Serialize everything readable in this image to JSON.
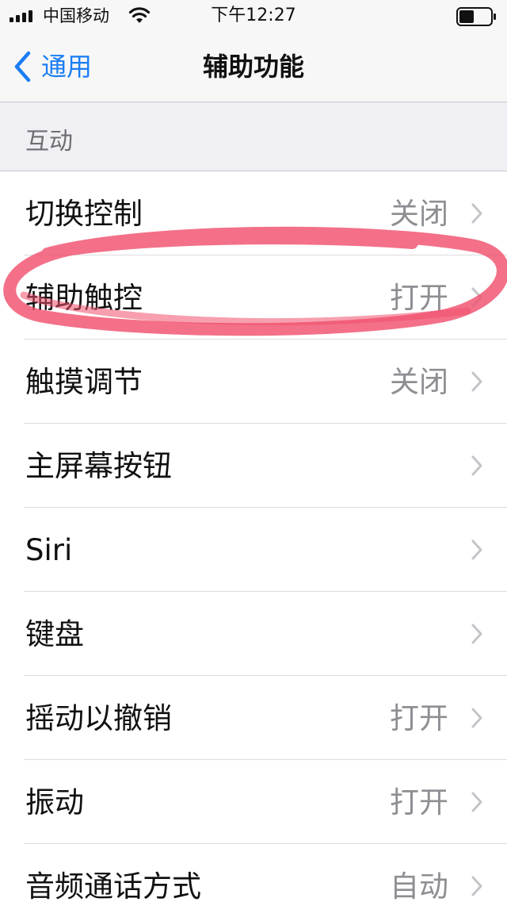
{
  "status_bar": {
    "carrier": "中国移动",
    "time": "下午12:27"
  },
  "nav": {
    "back_label": "通用",
    "title": "辅助功能"
  },
  "section": {
    "title": "互动"
  },
  "rows": [
    {
      "label": "切换控制",
      "value": "关闭"
    },
    {
      "label": "辅助触控",
      "value": "打开"
    },
    {
      "label": "触摸调节",
      "value": "关闭"
    },
    {
      "label": "主屏幕按钮",
      "value": ""
    },
    {
      "label": "Siri",
      "value": ""
    },
    {
      "label": "键盘",
      "value": ""
    },
    {
      "label": "摇动以撤销",
      "value": "打开"
    },
    {
      "label": "振动",
      "value": "打开"
    },
    {
      "label": "音频通话方式",
      "value": "自动"
    }
  ],
  "colors": {
    "accent": "#1a7df5",
    "annotation": "#f0506e"
  },
  "icons": {
    "back": "chevron-left-icon",
    "disclosure": "chevron-right-icon",
    "wifi": "wifi-icon",
    "battery": "battery-icon",
    "signal": "signal-bars-icon"
  }
}
